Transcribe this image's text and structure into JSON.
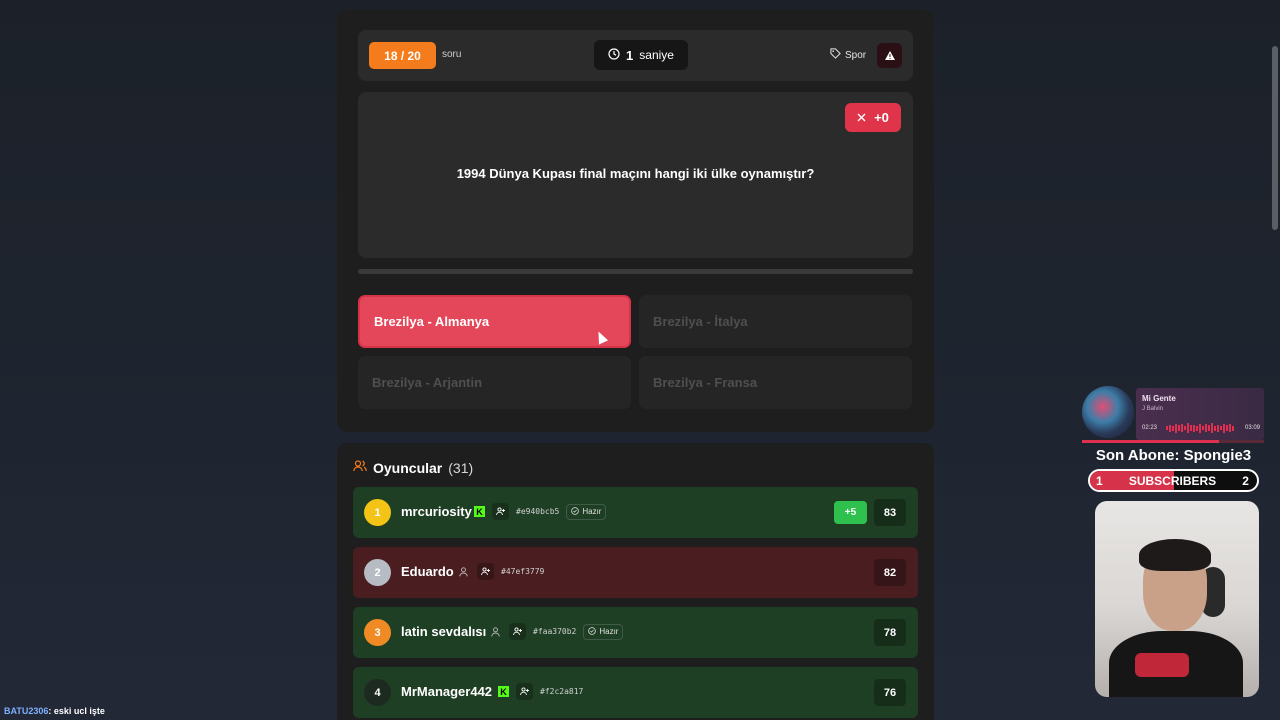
{
  "quiz": {
    "counter": "18 / 20",
    "counter_unit": "soru",
    "timer_value": "1",
    "timer_unit": "saniye",
    "category": "Spor",
    "score_delta": "+0",
    "question": "1994 Dünya Kupası final maçını hangi iki ülke oynamıştır?",
    "options": [
      {
        "label": "Brezilya - Almanya",
        "state": "selected"
      },
      {
        "label": "Brezilya - İtalya",
        "state": "disabled"
      },
      {
        "label": "Brezilya - Arjantin",
        "state": "disabled"
      },
      {
        "label": "Brezilya - Fransa",
        "state": "disabled"
      }
    ]
  },
  "players": {
    "title": "Oyuncular",
    "count": "(31)",
    "rows": [
      {
        "rank": "1",
        "name": "mrcuriosity",
        "hash": "#e940bcb5",
        "ready": "Hazır",
        "bonus": "+5",
        "score": "83",
        "status": "correct"
      },
      {
        "rank": "2",
        "name": "Eduardo",
        "hash": "#47ef3779",
        "ready": "",
        "bonus": "",
        "score": "82",
        "status": "wrong"
      },
      {
        "rank": "3",
        "name": "latin sevdalısı",
        "hash": "#faa370b2",
        "ready": "Hazır",
        "bonus": "",
        "score": "78",
        "status": "correct"
      },
      {
        "rank": "4",
        "name": "MrManager442",
        "hash": "#f2c2a817",
        "ready": "",
        "bonus": "",
        "score": "76",
        "status": "correct"
      }
    ]
  },
  "overlay": {
    "song": "Mi Gente",
    "artist": "J Balvin",
    "time_current": "02:23",
    "time_total": "03:09",
    "last_sub": "Son Abone: Spongie3",
    "sub_start": "1",
    "sub_label": "SUBSCRIBERS",
    "sub_goal": "2"
  },
  "chat": {
    "user": "BATU2306",
    "message": ": eski ucl işte"
  },
  "colors": {
    "accent_orange": "#f47c1c",
    "wrong_red": "#e5475a",
    "correct_green": "#2fc14e"
  }
}
